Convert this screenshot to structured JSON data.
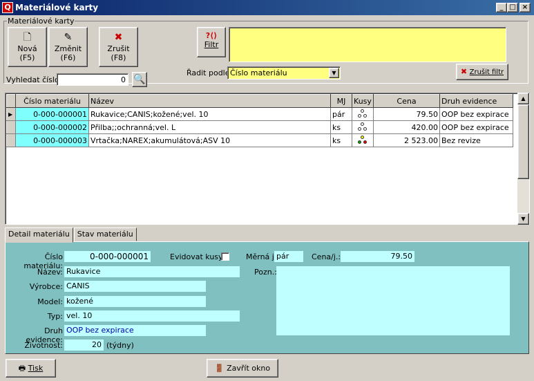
{
  "window": {
    "title": "Materiálové karty"
  },
  "groupbox": {
    "label": "Materiálové karty"
  },
  "toolbar": {
    "new_label": "Nová",
    "new_key": "(F5)",
    "edit_label": "Změnit",
    "edit_key": "(F6)",
    "delete_label": "Zrušit",
    "delete_key": "(F8)",
    "filter_label": "Filtr",
    "search_label": "Vyhledat číslo:",
    "search_value": "0",
    "sort_label": "Řadit podle:",
    "sort_value": "Číslo materiálu",
    "clear_filter_label": "Zrušit filtr"
  },
  "grid": {
    "columns": [
      "Číslo materiálu",
      "Název",
      "MJ",
      "Kusy",
      "Cena",
      "Druh evidence"
    ],
    "rows": [
      {
        "cislo": "0-000-000001",
        "nazev": "Rukavice;CANIS;kožené;vel. 10",
        "mj": "pár",
        "cena": "79.50",
        "druh": "OOP bez expirace",
        "kusy_color": "white"
      },
      {
        "cislo": "0-000-000002",
        "nazev": "Přilba;;ochranná;vel. L",
        "mj": "ks",
        "cena": "420.00",
        "druh": "OOP bez expirace",
        "kusy_color": "white"
      },
      {
        "cislo": "0-000-000003",
        "nazev": "Vrtačka;NAREX;akumulátová;ASV 10",
        "mj": "ks",
        "cena": "2 523.00",
        "druh": "Bez revize",
        "kusy_color": "traffic"
      }
    ]
  },
  "tabs": [
    "Detail materiálu",
    "Stav materiálu"
  ],
  "detail": {
    "cislo_label": "Číslo materiálu:",
    "cislo": "0-000-000001",
    "evidovat_label": "Evidovat kusy",
    "mj_label": "Měrná j.:",
    "mj": "pár",
    "cena_label": "Cena/j.:",
    "cena": "79.50",
    "nazev_label": "Název:",
    "nazev": "Rukavice",
    "pozn_label": "Pozn.:",
    "vyrobce_label": "Výrobce:",
    "vyrobce": "CANIS",
    "model_label": "Model:",
    "model": "kožené",
    "typ_label": "Typ:",
    "typ": "vel. 10",
    "druh_label": "Druh evidence:",
    "druh": "OOP bez expirace",
    "zivotnost_label": "Životnost:",
    "zivotnost": "20",
    "zivotnost_unit": "(týdny)"
  },
  "bottom": {
    "print_label": "Tisk",
    "close_label": "Zavřít okno"
  }
}
